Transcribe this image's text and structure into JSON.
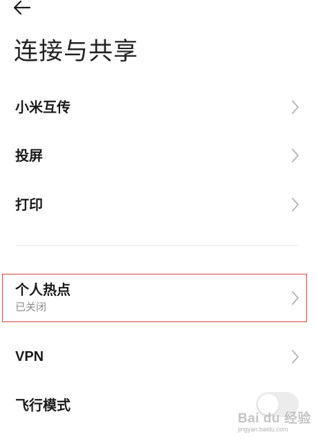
{
  "header": {
    "back_icon": "arrow-left-icon",
    "title": "连接与共享"
  },
  "items": [
    {
      "label": "小米互传",
      "sublabel": "",
      "icon": "chevron-right-icon"
    },
    {
      "label": "投屏",
      "sublabel": "",
      "icon": "chevron-right-icon"
    },
    {
      "label": "打印",
      "sublabel": "",
      "icon": "chevron-right-icon"
    },
    {
      "label": "个人热点",
      "sublabel": "已关闭",
      "icon": "chevron-right-icon",
      "highlighted": true
    },
    {
      "label": "VPN",
      "sublabel": "",
      "icon": "chevron-right-icon"
    },
    {
      "label": "飞行模式",
      "sublabel": "",
      "control": "toggle",
      "toggle_on": false
    }
  ],
  "watermark": {
    "text": "Bai du 经验",
    "sub": "jingyan.baidu.com"
  },
  "colors": {
    "highlight_border": "#d9413b",
    "text_primary": "#1a1a1a",
    "text_secondary": "#8c8c8c",
    "chevron": "#b3b3b3"
  }
}
